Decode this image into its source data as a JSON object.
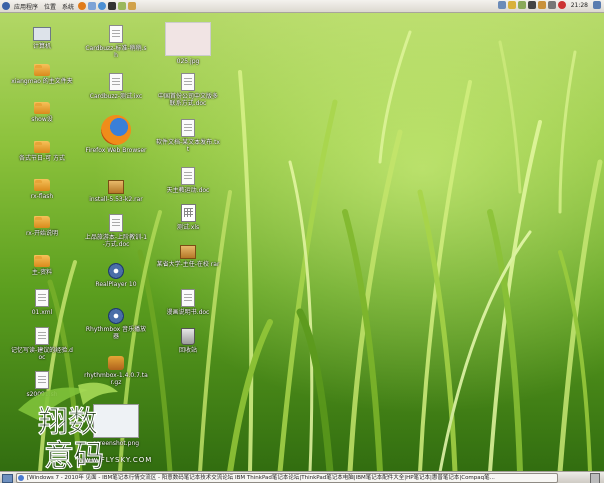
{
  "top_panel": {
    "menus": [
      "应用程序",
      "位置",
      "系统"
    ],
    "clock": "21:28"
  },
  "desktop_icons": {
    "computer": "计算机",
    "home": "xiangmao 的主文件夹",
    "show": "show设",
    "folder_dates": "各式节日-可 方式",
    "folder_flash": "rx-flash",
    "folder_4": "rx-开始说明",
    "folder_5": "主-资料",
    "file_xml": "01.xml",
    "doc_a": "记忆写读-建议的经验.doc",
    "sh_file": "s20091.sh",
    "cardbuzz": "Cardbuzz-标准-稍稍.sh",
    "cardbuzz2": "Cardbuzz-测试.ixc",
    "firefox": "Firefox Web Browser",
    "installer": "install-5.53-k2.rar",
    "upload_doc": "上品旅游本-上阶教训-1-方式.doc",
    "realplayer": "RealPlayer 10",
    "rhythmbox": "Rhythmbox 音乐播放器",
    "rhythmbox_tar": "rhythmbox-1.4.0.7.tar.gz",
    "image_jpg": "025.jpg",
    "doc_b": "中国首份公司中文版多 联系方式.doc",
    "doc_c": "软件文档-某文本发布.txt",
    "doc_d": "天主教运动.doc",
    "sheet_xls": "测试.xls",
    "rar_a": "某省大学-主任-在校 rar",
    "doc_e": "漫画说明书.doc",
    "trash": "回收站",
    "screenshot": "screenshot.png"
  },
  "watermark": {
    "line1": "翔数",
    "line2": "意码",
    "site": "www.FLYSKY.COM"
  },
  "taskbar": {
    "window_title": "[Windows 7 - 2010年 见面 - IBM笔记本行情交流区 - 阳意数码笔记本技术交流论坛 IBM ThinkPad笔记本论坛|ThinkPad笔记本电脑|IBM笔记本配件大全|HP笔记本|惠普笔记本|Compaq笔..."
  },
  "colors": {
    "grass_dark": "#2f6a0f",
    "grass_light": "#b6d96a",
    "panel": "#dcd8d0"
  }
}
